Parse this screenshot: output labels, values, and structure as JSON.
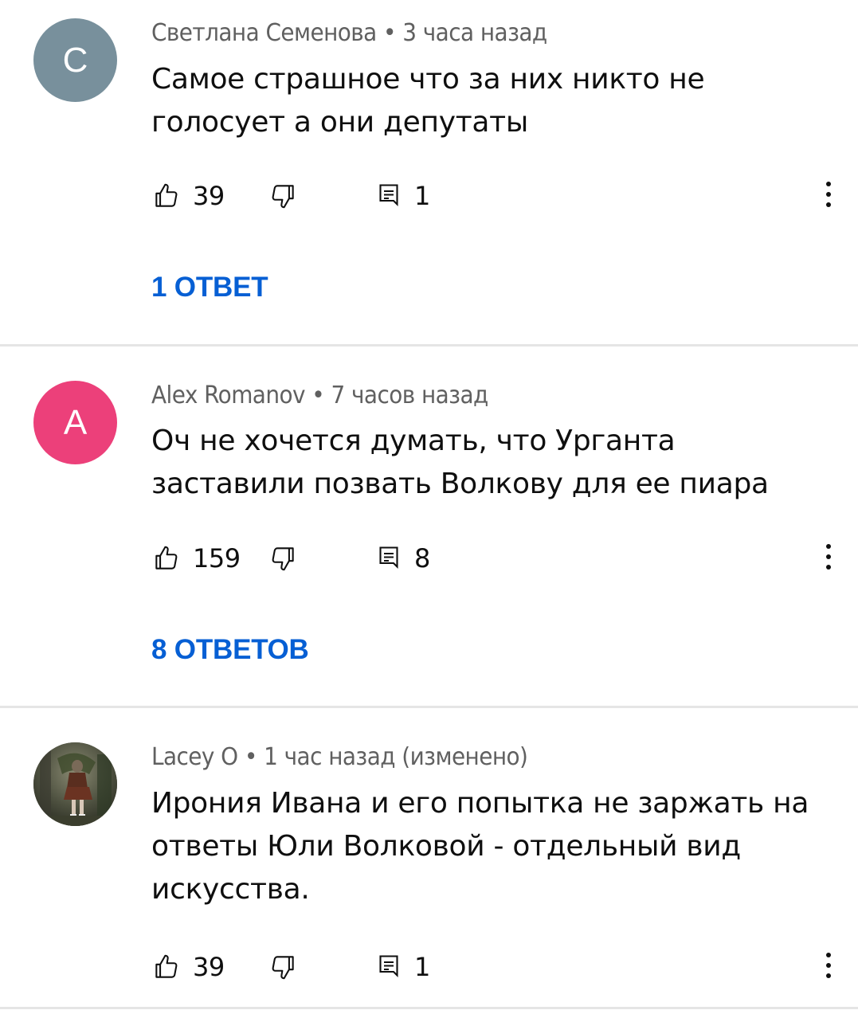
{
  "comments": [
    {
      "avatar_letter": "С",
      "avatar_color": "#78909c",
      "author": "Светлана Семенова",
      "time": "3 часа назад",
      "text_lines": [
        "Самое страшное что за них никто не",
        "голосует а они депутаты"
      ],
      "likes": "39",
      "replies_count": "1",
      "replies_button": "1 ОТВЕТ"
    },
    {
      "avatar_letter": "A",
      "avatar_color": "#ec407a",
      "author": "Alex Romanov",
      "time": "7 часов назад",
      "text_lines": [
        "Оч не хочется думать, что Урганта",
        "заставили позвать Волкову для ее пиара"
      ],
      "likes": "159",
      "replies_count": "8",
      "replies_button": "8 ОТВЕТОВ"
    },
    {
      "avatar_letter": "",
      "avatar_color": "#5b5a4e",
      "author": "Lacey O",
      "time": "1 час назад (изменено)",
      "text_lines": [
        "Ирония Ивана и его попытка не заржать на",
        "ответы Юли Волковой - отдельный вид",
        "искусства."
      ],
      "likes": "39",
      "replies_count": "1"
    }
  ],
  "separator": "•",
  "icons": {
    "like": "thumbs-up-icon",
    "dislike": "thumbs-down-icon",
    "reply": "comment-reply-icon",
    "more": "vertical-ellipsis-icon"
  },
  "colors": {
    "link_blue": "#065fd4",
    "meta_gray": "#606060",
    "divider": "#e5e5e5"
  }
}
